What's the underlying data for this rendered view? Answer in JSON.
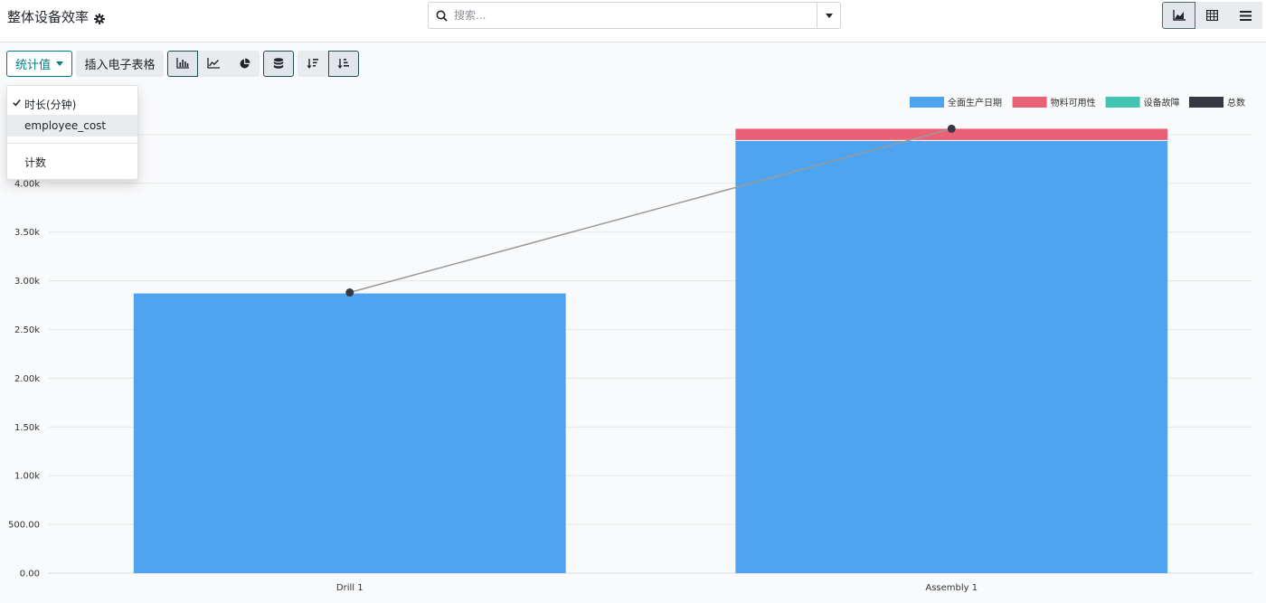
{
  "header": {
    "title": "整体设备效率"
  },
  "search": {
    "placeholder": "搜索..."
  },
  "view_switcher": {
    "active": "graph",
    "views": [
      "graph",
      "pivot",
      "list"
    ]
  },
  "toolbar": {
    "measures_label": "统计值",
    "insert_sheet_label": "插入电子表格",
    "chart_types": [
      "bar",
      "line",
      "pie"
    ],
    "active_chart_type": "bar",
    "stacked": true,
    "sort_active": "ascending"
  },
  "measures_dropdown": {
    "items": [
      {
        "label": "时长(分钟)",
        "checked": true
      },
      {
        "label": "employee_cost",
        "checked": false
      }
    ],
    "count_label": "计数"
  },
  "colors": {
    "accent": "#017e84",
    "blue": "#4ea4ef",
    "red": "#ea6175",
    "teal": "#43c5b1",
    "dark": "#353a42",
    "line": "#9a9a9a"
  },
  "chart_data": {
    "type": "bar",
    "stacked": true,
    "categories": [
      "Drill 1",
      "Assembly 1"
    ],
    "series": [
      {
        "name": "全面生产日期",
        "values": [
          2870,
          4440
        ]
      },
      {
        "name": "物料可用性",
        "values": [
          0,
          120
        ]
      },
      {
        "name": "设备故障",
        "values": [
          0,
          0
        ]
      },
      {
        "name": "总数",
        "values": [
          0,
          0
        ]
      }
    ],
    "line": {
      "values": [
        2880,
        4560
      ]
    },
    "y_ticks": [
      "0.00",
      "500.00",
      "1.00k",
      "1.50k",
      "2.00k",
      "2.50k",
      "3.00k",
      "3.50k",
      "4.00k"
    ],
    "ylim": [
      0,
      5000
    ],
    "grid": true,
    "legend_position": "top-right"
  }
}
